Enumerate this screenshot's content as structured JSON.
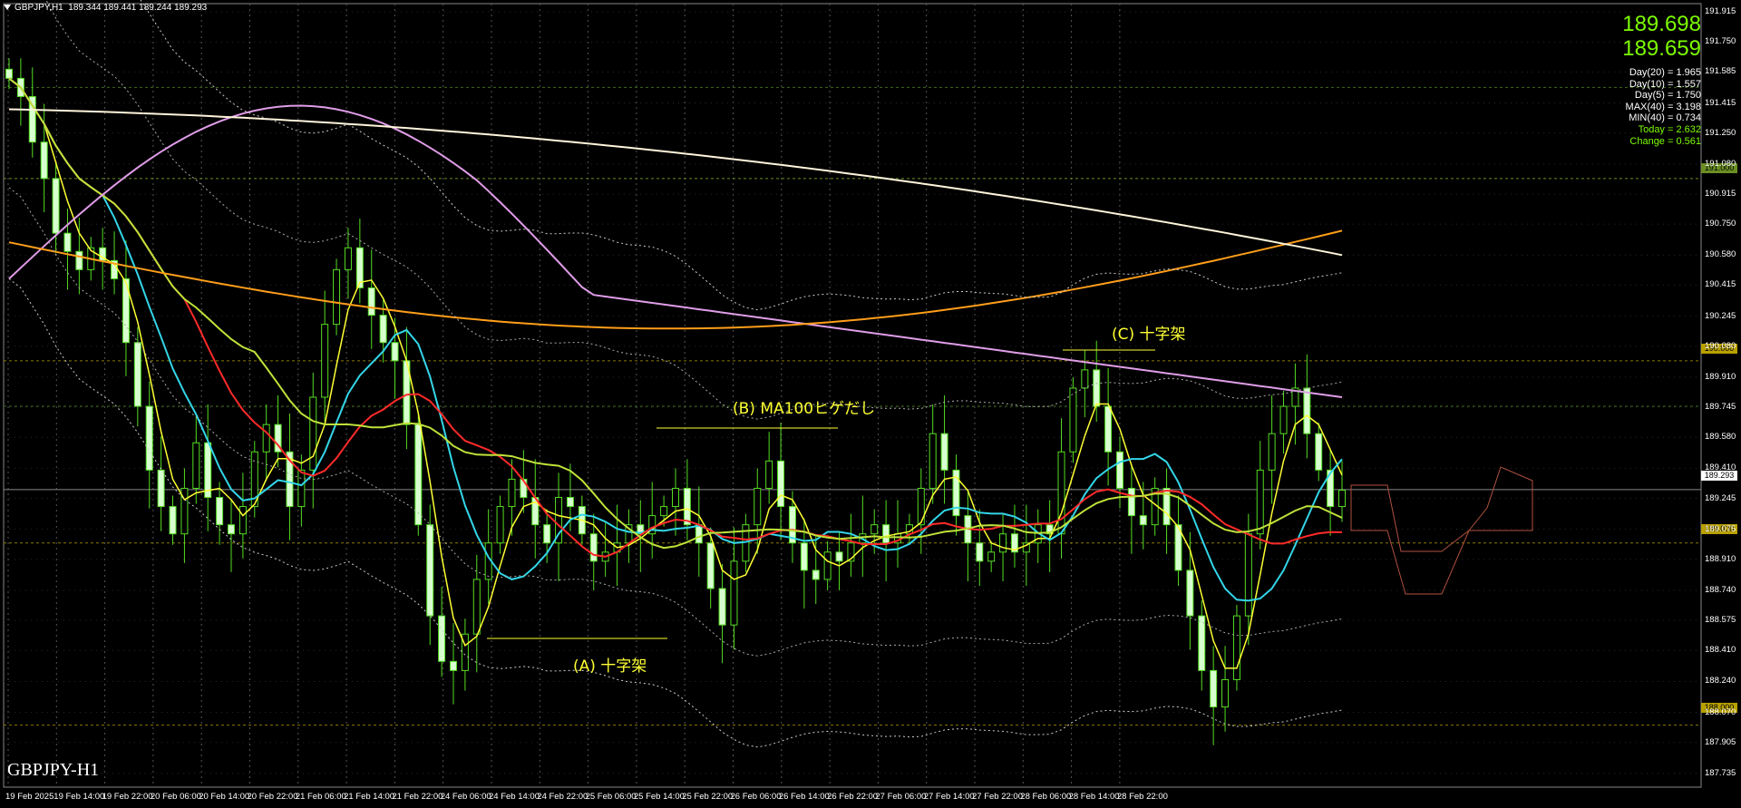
{
  "header": {
    "symbol_tf": "GBPJPY,H1",
    "ohlc": "189.344 189.441 189.244 189.293"
  },
  "symbol_label": "GBPJPY-H1",
  "prices": {
    "bid": "189.698",
    "ask": "189.659"
  },
  "stats": [
    {
      "text": "Day(20) = 1.965",
      "color": "#ffffff"
    },
    {
      "text": "Day(10) = 1.557",
      "color": "#ffffff"
    },
    {
      "text": "Day(5) = 1.750",
      "color": "#ffffff"
    },
    {
      "text": "MAX(40) = 3.198",
      "color": "#ffffff"
    },
    {
      "text": "MIN(40) = 0.734",
      "color": "#ffffff"
    },
    {
      "text": "Today = 2.632",
      "color": "#7cfc00"
    },
    {
      "text": "Change = 0.561",
      "color": "#7cfc00"
    }
  ],
  "annotations": {
    "a": "(A)  十字架",
    "b": "(B)  MA100ヒゲだし",
    "c": "(C)  十字架"
  },
  "price_boxes": {
    "current": "189.293",
    "b191": "191.000",
    "b190": "190.000",
    "b189": "189.000",
    "b188": "188.000"
  },
  "chart_data": {
    "type": "candlestick",
    "y_ticks": [
      "191.915",
      "191.750",
      "191.585",
      "191.415",
      "191.250",
      "191.080",
      "190.915",
      "190.750",
      "190.580",
      "190.415",
      "190.245",
      "190.080",
      "189.910",
      "189.745",
      "189.580",
      "189.410",
      "189.245",
      "189.075",
      "188.910",
      "188.740",
      "188.575",
      "188.410",
      "188.240",
      "188.070",
      "187.905",
      "187.735"
    ],
    "x_ticks": [
      "19 Feb 2025",
      "19 Feb 14:00",
      "19 Feb 22:00",
      "20 Feb 06:00",
      "20 Feb 14:00",
      "20 Feb 22:00",
      "21 Feb 06:00",
      "21 Feb 14:00",
      "21 Feb 22:00",
      "24 Feb 06:00",
      "24 Feb 14:00",
      "24 Feb 22:00",
      "25 Feb 06:00",
      "25 Feb 14:00",
      "25 Feb 22:00",
      "26 Feb 06:00",
      "26 Feb 14:00",
      "26 Feb 22:00",
      "27 Feb 06:00",
      "27 Feb 14:00",
      "27 Feb 22:00",
      "28 Feb 06:00",
      "28 Feb 14:00",
      "28 Feb 22:00"
    ],
    "ylim": [
      187.66,
      191.96
    ],
    "last_price": 189.293,
    "levels": [
      191.0,
      190.0,
      189.0,
      188.0
    ],
    "closes": [
      191.55,
      191.45,
      191.2,
      191.0,
      190.7,
      190.6,
      190.5,
      190.62,
      190.55,
      190.45,
      190.1,
      189.75,
      189.4,
      189.2,
      189.05,
      189.3,
      189.55,
      189.25,
      189.1,
      189.05,
      189.2,
      189.5,
      189.65,
      189.5,
      189.2,
      189.4,
      189.8,
      190.2,
      190.5,
      190.62,
      190.4,
      190.25,
      190.1,
      190.0,
      189.65,
      189.1,
      188.6,
      188.35,
      188.3,
      188.5,
      188.8,
      189.0,
      189.2,
      189.35,
      189.25,
      189.1,
      189.0,
      189.25,
      189.2,
      189.05,
      188.9,
      188.95,
      189.0,
      189.1,
      189.05,
      189.15,
      189.2,
      189.3,
      189.1,
      189.0,
      188.75,
      188.55,
      188.9,
      189.1,
      189.3,
      189.45,
      189.2,
      189.0,
      188.85,
      188.8,
      188.95,
      188.9,
      189.0,
      189.05,
      189.1,
      189.0,
      189.05,
      189.1,
      189.3,
      189.6,
      189.4,
      189.15,
      189.0,
      188.9,
      188.95,
      189.05,
      188.95,
      189.0,
      189.1,
      189.05,
      189.5,
      189.85,
      189.95,
      189.75,
      189.5,
      189.3,
      189.15,
      189.1,
      189.3,
      189.1,
      188.85,
      188.6,
      188.3,
      188.1,
      188.25,
      188.6,
      189.05,
      189.4,
      189.6,
      189.75,
      189.85,
      189.6,
      189.4,
      189.2,
      189.29
    ],
    "series": [
      {
        "name": "MA20",
        "color": "#ffff33"
      },
      {
        "name": "MA40",
        "color": "#33d6e8"
      },
      {
        "name": "MA75",
        "color": "#ff2a2a"
      },
      {
        "name": "MA100",
        "color": "#bfe23a"
      },
      {
        "name": "MA200",
        "color": "#e09de8"
      },
      {
        "name": "MA300",
        "color": "#ff9e1a"
      },
      {
        "name": "MA500",
        "color": "#fff5dc"
      }
    ]
  }
}
